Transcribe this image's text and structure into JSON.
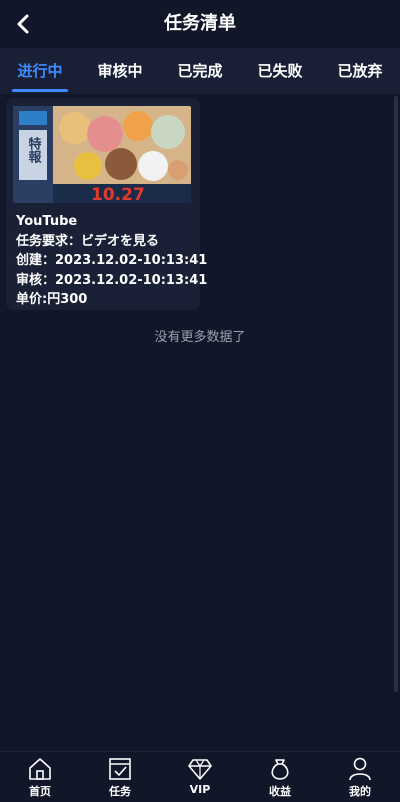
{
  "header": {
    "title": "任务清单",
    "back_icon": "chevron-left-icon"
  },
  "tabs": [
    {
      "label": "进行中",
      "active": true
    },
    {
      "label": "审核中",
      "active": false
    },
    {
      "label": "已完成",
      "active": false
    },
    {
      "label": "已失败",
      "active": false
    },
    {
      "label": "已放弃",
      "active": false
    }
  ],
  "task": {
    "platform": "YouTube",
    "requirement": "任务要求：ビデオを見る",
    "created": "创建：2023.12.02-10:13:41",
    "reviewed": "审核：2023.12.02-10:13:41",
    "price": "单价:円300",
    "thumbnail": {
      "badge_text": "特報",
      "date_text": "10.27"
    }
  },
  "no_more": "没有更多数据了",
  "nav": [
    {
      "label": "首页",
      "icon": "home-icon"
    },
    {
      "label": "任务",
      "icon": "task-icon"
    },
    {
      "label": "VIP",
      "icon": "diamond-icon"
    },
    {
      "label": "收益",
      "icon": "moneybag-icon"
    },
    {
      "label": "我的",
      "icon": "user-icon"
    }
  ],
  "colors": {
    "background": "#111729",
    "tab_bar": "#192035",
    "card": "#1a2136",
    "accent": "#3f8cff",
    "muted_text": "#9aa0ae"
  }
}
